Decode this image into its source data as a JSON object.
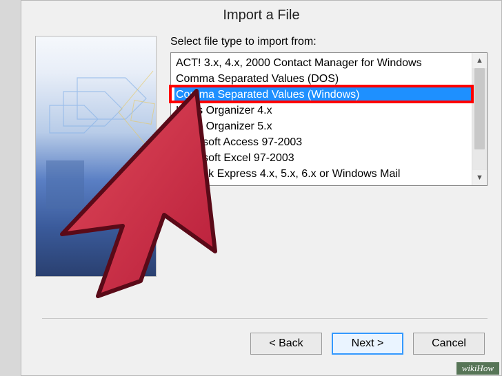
{
  "dialog": {
    "title": "Import a File",
    "prompt": "Select file type to import from:",
    "items": [
      "ACT! 3.x, 4.x, 2000 Contact Manager for Windows",
      "Comma Separated Values (DOS)",
      "Comma Separated Values (Windows)",
      "Lotus Organizer 4.x",
      "Lotus Organizer 5.x",
      "Microsoft Access 97-2003",
      "Microsoft Excel 97-2003",
      "Outlook Express 4.x, 5.x, 6.x or Windows Mail"
    ],
    "selected_index": 2
  },
  "buttons": {
    "back": "< Back",
    "next": "Next >",
    "cancel": "Cancel"
  },
  "watermark": "wikiHow"
}
